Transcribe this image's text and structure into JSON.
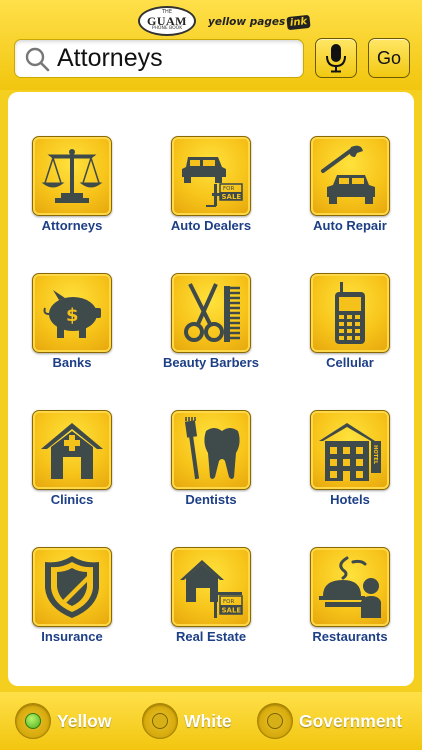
{
  "header": {
    "guam_logo": {
      "top": "THE",
      "main": "GUAM",
      "bottom": "PHONE BOOK"
    },
    "yp_logo": {
      "text": "yellow pages",
      "ink": "ink"
    }
  },
  "search": {
    "value": "Attorneys",
    "placeholder": ""
  },
  "buttons": {
    "go_label": "Go"
  },
  "categories": [
    {
      "label": "Attorneys",
      "icon": "scales-icon"
    },
    {
      "label": "Auto Dealers",
      "icon": "car-for-sale-icon"
    },
    {
      "label": "Auto Repair",
      "icon": "car-wrench-icon"
    },
    {
      "label": "Banks",
      "icon": "piggy-bank-icon"
    },
    {
      "label": "Beauty Barbers",
      "icon": "scissors-comb-icon"
    },
    {
      "label": "Cellular",
      "icon": "cell-phone-icon"
    },
    {
      "label": "Clinics",
      "icon": "clinic-house-icon"
    },
    {
      "label": "Dentists",
      "icon": "tooth-brush-icon"
    },
    {
      "label": "Hotels",
      "icon": "hotel-icon"
    },
    {
      "label": "Insurance",
      "icon": "shield-icon"
    },
    {
      "label": "Real Estate",
      "icon": "house-for-sale-icon"
    },
    {
      "label": "Restaurants",
      "icon": "waiter-platter-icon"
    }
  ],
  "icon_text": {
    "sale": "SALE",
    "for": "FOR",
    "hotel": "HOTEL"
  },
  "footer": {
    "options": [
      {
        "label": "Yellow",
        "selected": true
      },
      {
        "label": "White",
        "selected": false
      },
      {
        "label": "Government",
        "selected": false
      }
    ]
  },
  "colors": {
    "brand_yellow": "#f5cf1f",
    "label_blue": "#1d3f86",
    "icon_dark": "#3f4a4a"
  }
}
